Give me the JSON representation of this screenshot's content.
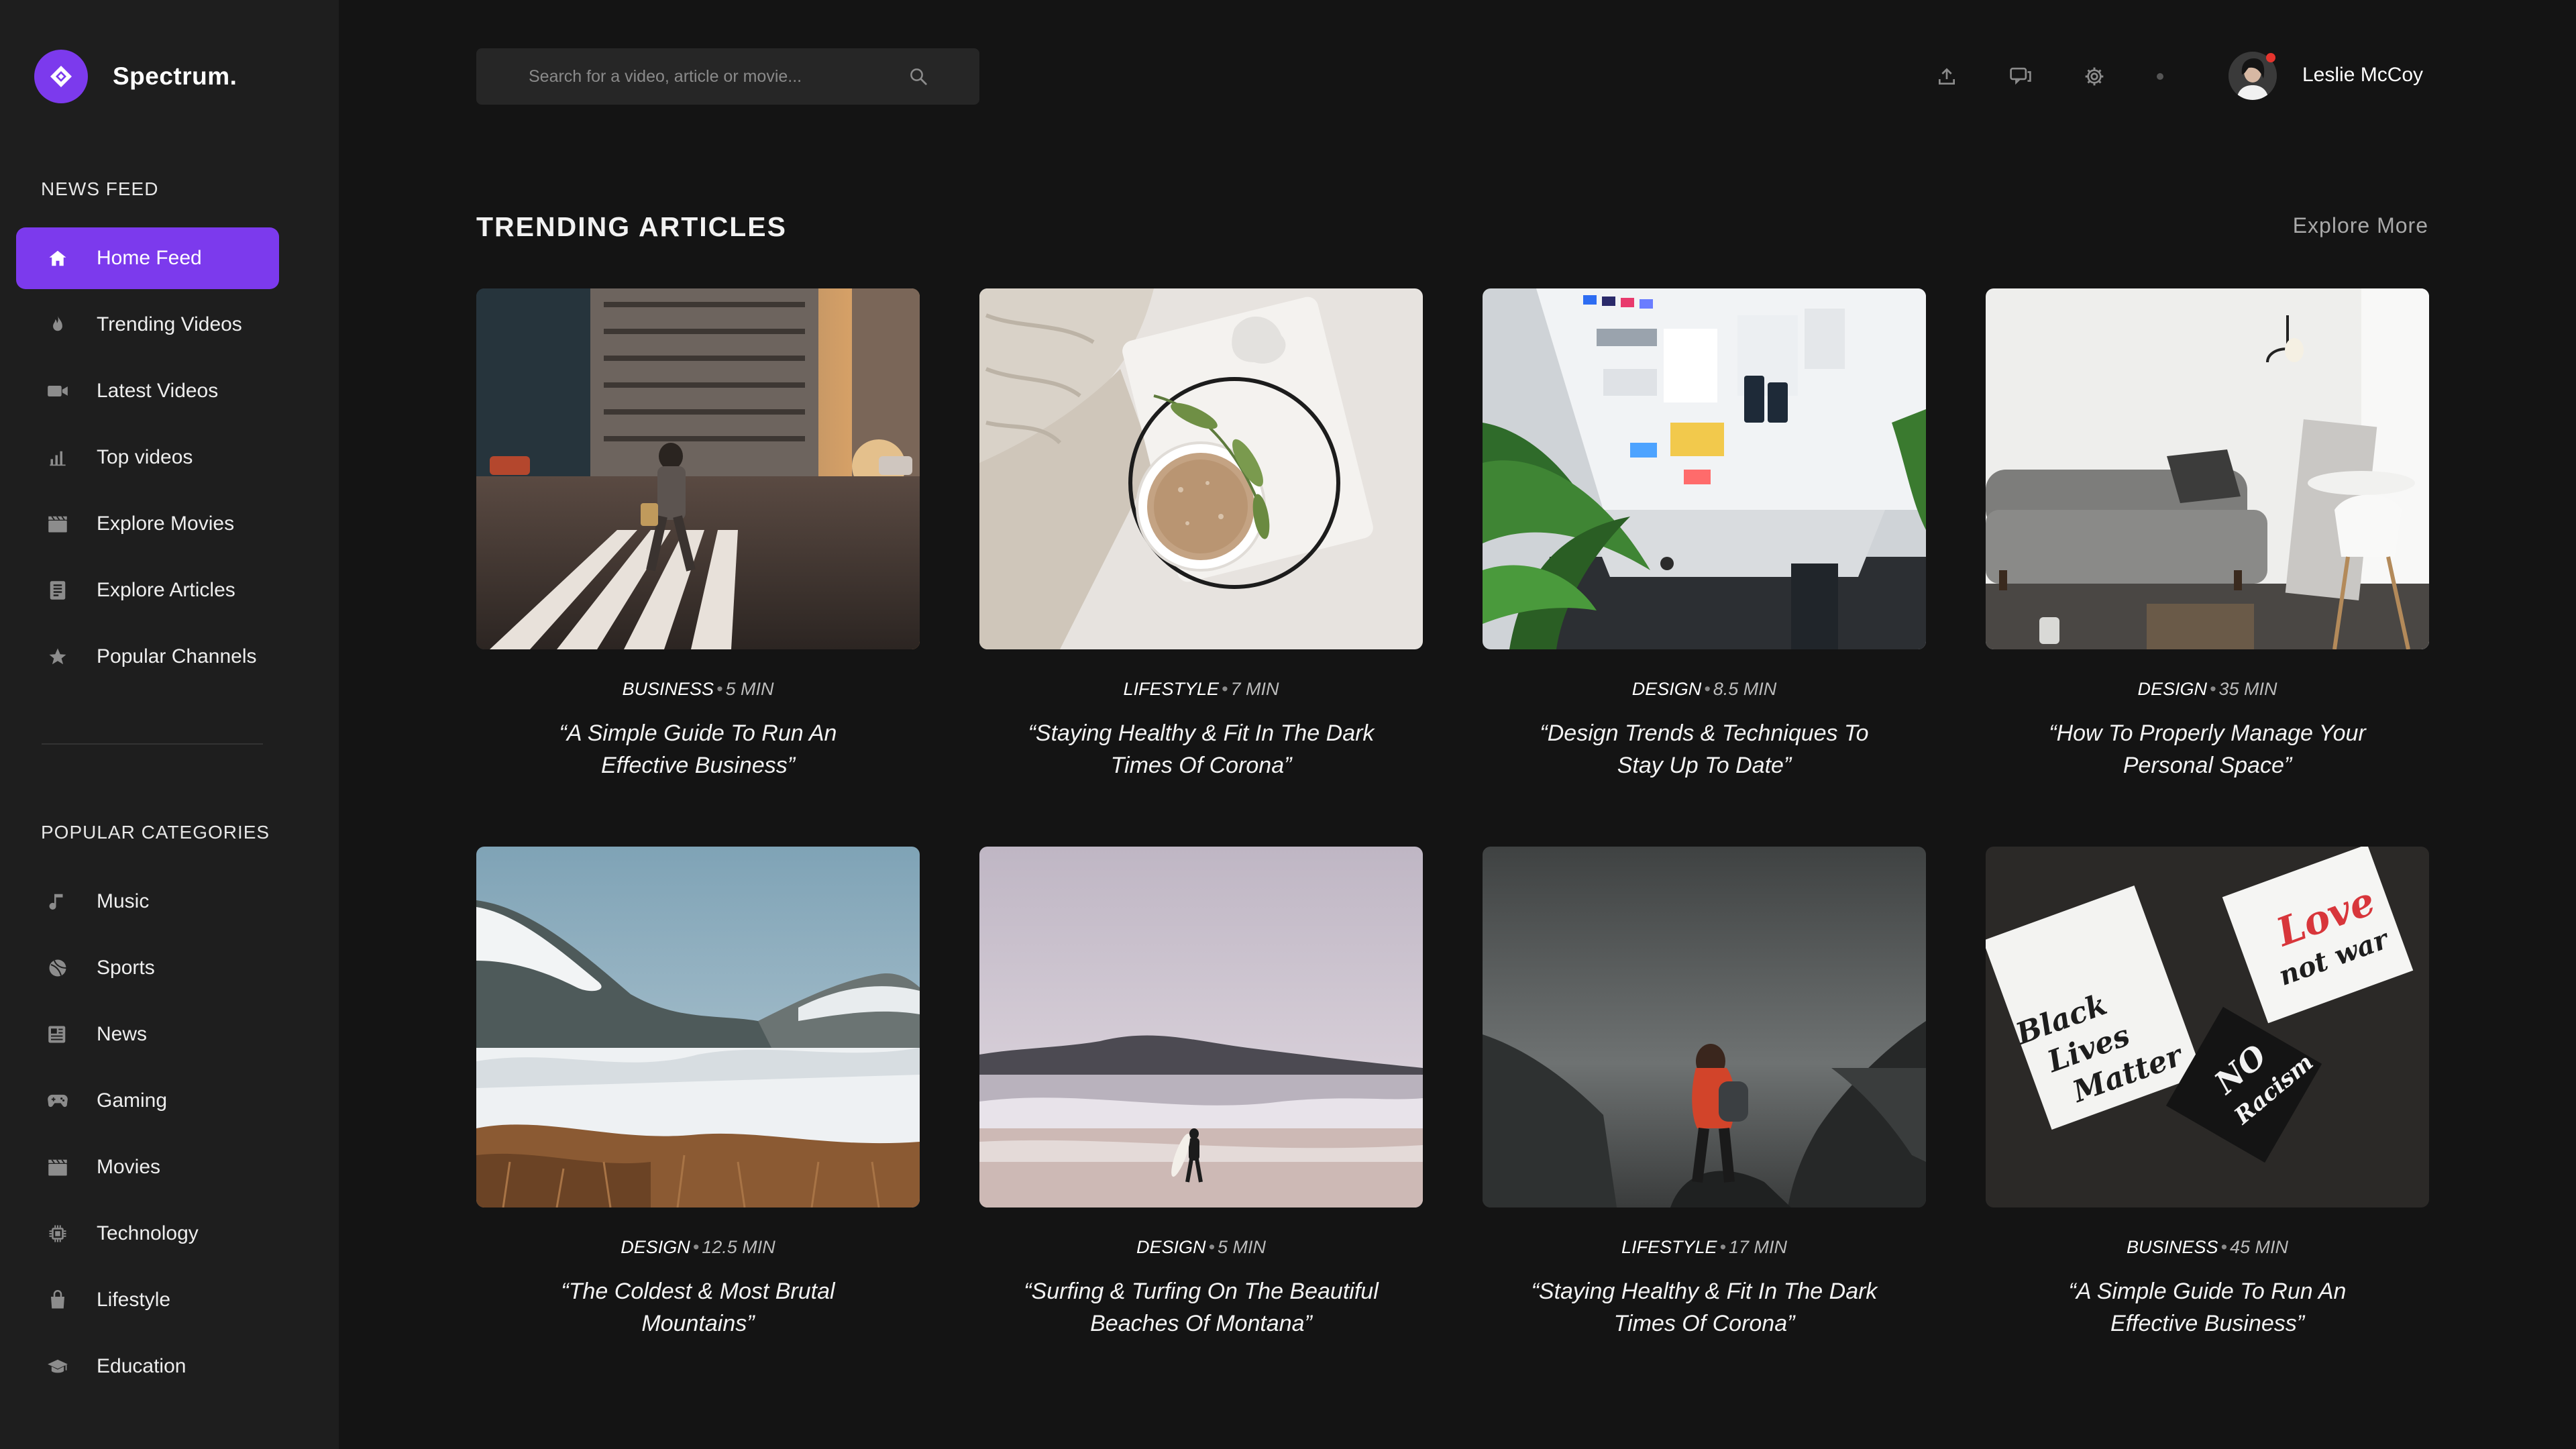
{
  "brand": {
    "name": "Spectrum."
  },
  "sidebar": {
    "news_title": "NEWS FEED",
    "news_items": [
      {
        "label": "Home Feed",
        "icon": "home-icon",
        "active": true
      },
      {
        "label": "Trending Videos",
        "icon": "flame-icon"
      },
      {
        "label": "Latest Videos",
        "icon": "video-camera-icon"
      },
      {
        "label": "Top videos",
        "icon": "bar-chart-icon"
      },
      {
        "label": "Explore Movies",
        "icon": "clapperboard-icon"
      },
      {
        "label": "Explore Articles",
        "icon": "article-icon"
      },
      {
        "label": "Popular Channels",
        "icon": "star-icon"
      }
    ],
    "categories_title": "POPULAR CATEGORIES",
    "categories": [
      {
        "label": "Music",
        "icon": "music-note-icon"
      },
      {
        "label": "Sports",
        "icon": "ball-icon"
      },
      {
        "label": "News",
        "icon": "newspaper-icon"
      },
      {
        "label": "Gaming",
        "icon": "gamepad-icon"
      },
      {
        "label": "Movies",
        "icon": "clapperboard-icon"
      },
      {
        "label": "Technology",
        "icon": "chip-icon"
      },
      {
        "label": "Lifestyle",
        "icon": "shopping-bag-icon"
      },
      {
        "label": "Education",
        "icon": "graduation-cap-icon"
      }
    ]
  },
  "search": {
    "placeholder": "Search for a video, article or movie..."
  },
  "user": {
    "name": "Leslie McCoy"
  },
  "main": {
    "heading": "TRENDING ARTICLES",
    "explore_more": "Explore More",
    "articles": [
      {
        "category": "BUSINESS",
        "duration": "5 MIN",
        "title": "“A Simple Guide To Run An Effective Business”"
      },
      {
        "category": "LIFESTYLE",
        "duration": "7 MIN",
        "title": "“Staying Healthy & Fit In The Dark Times Of Corona”"
      },
      {
        "category": "DESIGN",
        "duration": "8.5 MIN",
        "title": "“Design Trends & Techniques To Stay Up To Date”"
      },
      {
        "category": "DESIGN",
        "duration": "35 MIN",
        "title": "“How To Properly Manage Your Personal Space”"
      },
      {
        "category": "DESIGN",
        "duration": "12.5 MIN",
        "title": "“The Coldest & Most Brutal Mountains”"
      },
      {
        "category": "DESIGN",
        "duration": "5 MIN",
        "title": "“Surfing & Turfing On The Beautiful Beaches Of Montana”"
      },
      {
        "category": "LIFESTYLE",
        "duration": "17 MIN",
        "title": "“Staying Healthy & Fit In The Dark Times Of Corona”"
      },
      {
        "category": "BUSINESS",
        "duration": "45 MIN",
        "title": "“A Simple Guide To Run An Effective Business”"
      }
    ],
    "note_card": {
      "line1": "Black",
      "line2": "Lives",
      "line3": "Matter",
      "love": "Love",
      "notwar": "not war",
      "no": "NO",
      "racism": "Racism"
    }
  },
  "colors": {
    "accent": "#7c3aed",
    "background": "#141414",
    "sidebar": "#1e1e1e"
  }
}
